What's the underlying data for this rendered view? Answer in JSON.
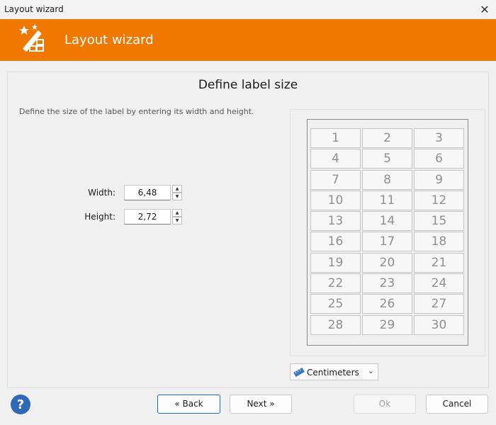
{
  "window": {
    "title": "Layout wizard",
    "close_glyph": "✕"
  },
  "banner": {
    "title": "Layout wizard",
    "icon": "magic-wand-icon",
    "color": "#f07800"
  },
  "page": {
    "title": "Define label size",
    "description": "Define the size of the label by entering its width and height."
  },
  "fields": {
    "width": {
      "label": "Width:",
      "value": "6,48"
    },
    "height": {
      "label": "Height:",
      "value": "2,72"
    }
  },
  "preview": {
    "cells": [
      "1",
      "2",
      "3",
      "4",
      "5",
      "6",
      "7",
      "8",
      "9",
      "10",
      "11",
      "12",
      "13",
      "14",
      "15",
      "16",
      "17",
      "18",
      "19",
      "20",
      "21",
      "22",
      "23",
      "24",
      "25",
      "26",
      "27",
      "28",
      "29",
      "30"
    ]
  },
  "units": {
    "selected": "Centimeters",
    "icon": "ruler-icon"
  },
  "buttons": {
    "back": "« Back",
    "next": "Next »",
    "ok": "Ok",
    "cancel": "Cancel",
    "help_icon": "help-icon"
  },
  "colors": {
    "accent": "#f07800",
    "help": "#2e6ab8",
    "focus": "#1e6ccf"
  }
}
